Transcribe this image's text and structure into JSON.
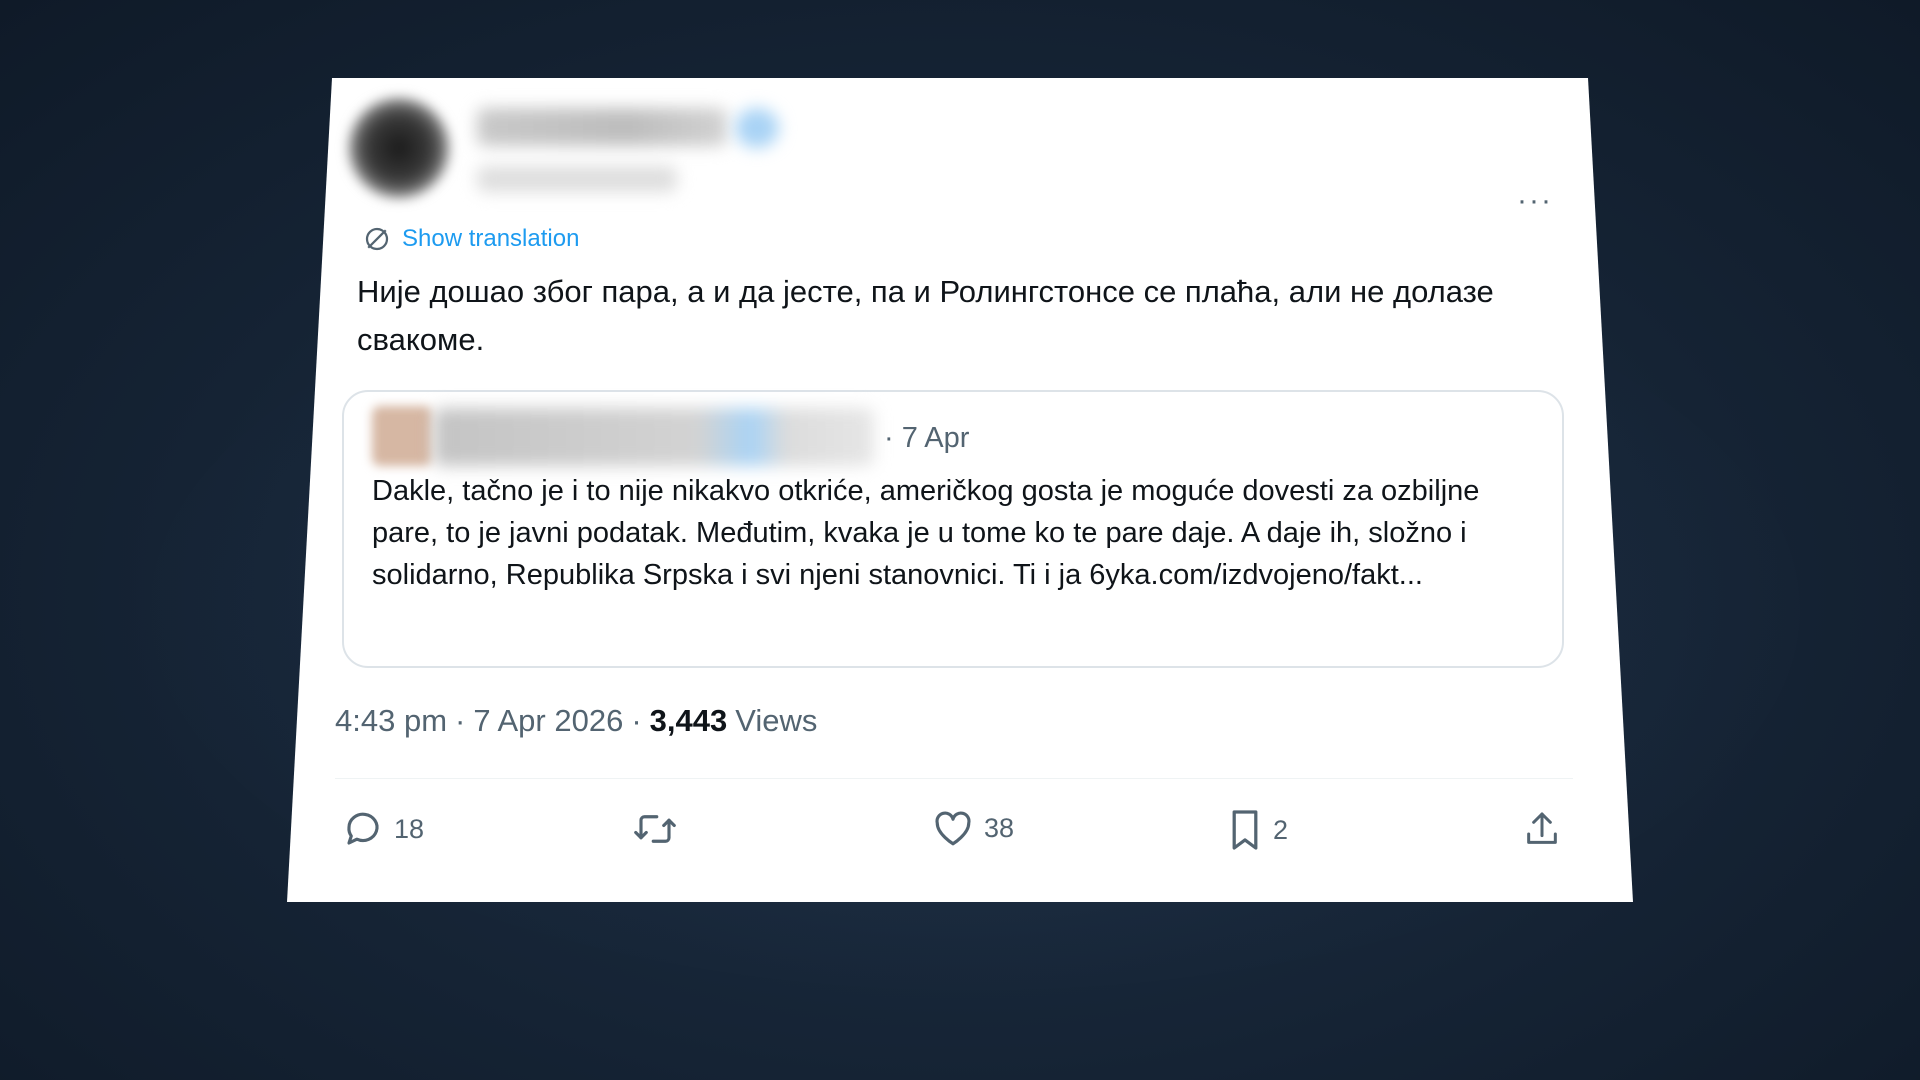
{
  "post": {
    "translate_label": "Show translation",
    "text": "Није дошао због пара, а и да јесте, па и Ролингстонсе се плаћа, али не долазе свакоме.",
    "quoted": {
      "date": "· 7 Apr",
      "text": "Dakle, tačno je i to nije nikakvo otkriće, američkog gosta je moguće dovesti za ozbiljne pare, to je javni podatak. Međutim, kvaka je u tome ko te pare daje. A daje ih, složno i solidarno, Republika Srpska i svi njeni stanovnici. Ti i ja 6yka.com/izdvojeno/fakt..."
    },
    "time": "4:43 pm",
    "date": "7 Apr 2026",
    "views_count": "3,443",
    "views_label": "Views",
    "separator": "·"
  },
  "actions": {
    "replies": "18",
    "reposts": "",
    "likes": "38",
    "bookmarks": "2"
  },
  "menu": {
    "more": "···"
  },
  "colors": {
    "accent": "#1d9bf0",
    "secondary_text": "#536471",
    "primary_text": "#0f1419"
  },
  "icons": {
    "translate": "translate-icon",
    "reply": "reply-icon",
    "repost": "repost-icon",
    "like": "heart-icon",
    "bookmark": "bookmark-icon",
    "share": "share-icon",
    "more": "more-icon"
  }
}
